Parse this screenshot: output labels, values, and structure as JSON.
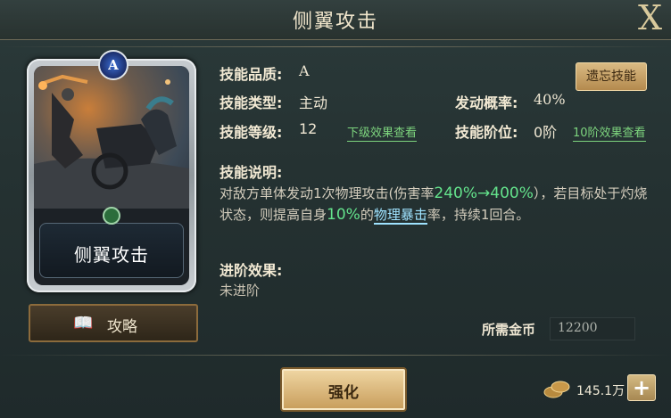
{
  "header": {
    "title": "侧翼攻击",
    "close_label": "X"
  },
  "card": {
    "name": "侧翼攻击",
    "grade_badge": "A"
  },
  "strategy_button": {
    "label": "攻略",
    "icon": "book-icon"
  },
  "info": {
    "quality_label": "技能品质:",
    "quality_value": "A",
    "type_label": "技能类型:",
    "type_value": "主动",
    "level_label": "技能等级:",
    "level_value": "12",
    "next_level_link": "下级效果查看",
    "chance_label": "发动概率:",
    "chance_value": "40%",
    "tier_label": "技能阶位:",
    "tier_value": "0阶",
    "tier10_link": "10阶效果查看",
    "forget_button": "遗忘技能"
  },
  "description": {
    "label": "技能说明:",
    "part1": "对敌方单体发动1次物理攻击(伤害率",
    "dmg_range": "240%→400%",
    "part2": "），若目标处于灼烧状态，则提高自身",
    "boost": "10%",
    "part3": "的",
    "keyword": "物理暴击",
    "part4": "率，持续1回合。"
  },
  "advance": {
    "label": "进阶效果:",
    "value": "未进阶"
  },
  "cost": {
    "label": "所需金币",
    "value": "12200"
  },
  "footer": {
    "enhance_label": "强化",
    "coin_amount": "145.1万",
    "plus_label": "+"
  },
  "colors": {
    "accent_green": "#64e38c",
    "keyword_blue": "#9fe3ff",
    "gold": "#c79c5a"
  }
}
